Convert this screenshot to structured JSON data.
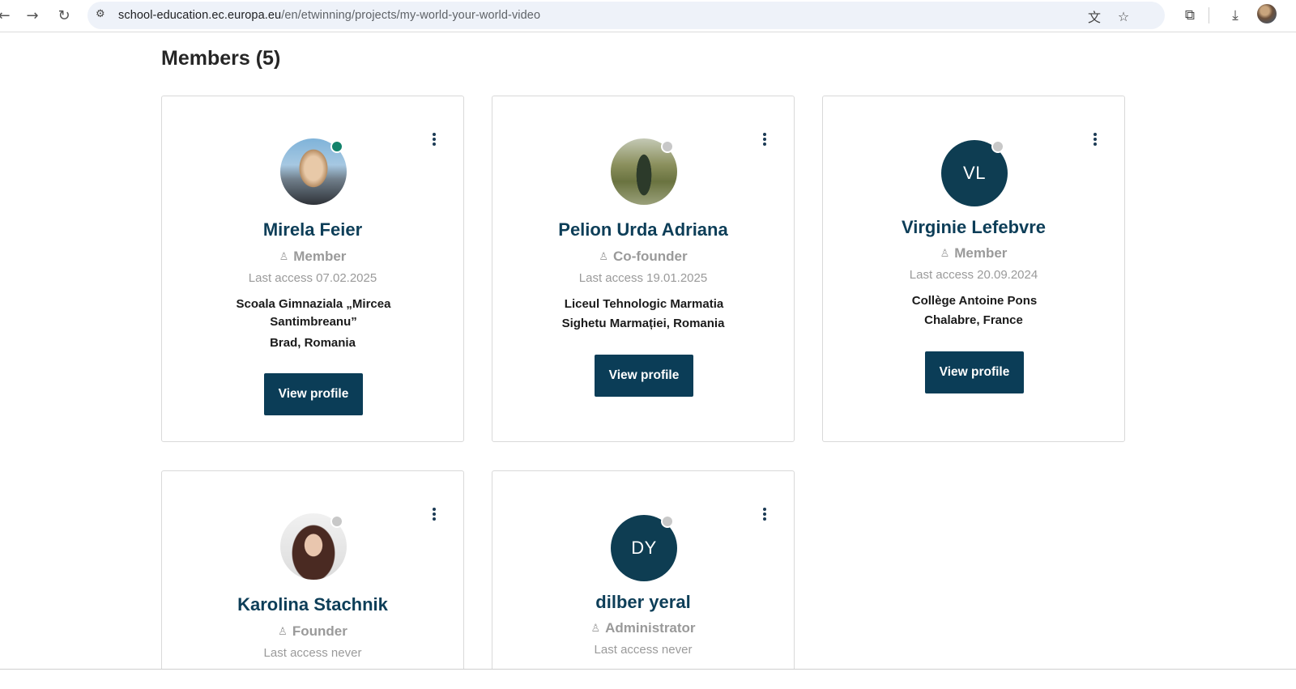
{
  "browser": {
    "url_host": "school-education.ec.europa.eu",
    "url_path": "/en/etwinning/projects/my-world-your-world-video",
    "icons": [
      "back-icon",
      "forward-icon",
      "reload-icon",
      "site-settings-icon",
      "translate-icon",
      "bookmark-star-icon",
      "extensions-icon",
      "download-icon",
      "profile-avatar"
    ]
  },
  "page": {
    "heading": "Members (5)"
  },
  "members": [
    {
      "name": "Mirela Feier",
      "role": "Member",
      "last_access": "Last access 07.02.2025",
      "org": "Scoala Gimnaziala „Mircea Santimbreanu”",
      "location": "Brad, Romania",
      "button": "View profile",
      "status": "online"
    },
    {
      "name": "Pelion Urda Adriana",
      "role": "Co-founder",
      "last_access": "Last access 19.01.2025",
      "org": "Liceul Tehnologic Marmatia",
      "location": "Sighetu Marmației, Romania",
      "button": "View profile",
      "status": "offline"
    },
    {
      "name": "Virginie Lefebvre",
      "initials": "VL",
      "role": "Member",
      "last_access": "Last access 20.09.2024",
      "org": "Collège Antoine Pons",
      "location": "Chalabre, France",
      "button": "View profile",
      "status": "offline"
    },
    {
      "name": "Karolina Stachnik",
      "role": "Founder",
      "last_access": "Last access never",
      "status": "offline"
    },
    {
      "name": "dilber yeral",
      "initials": "DY",
      "role": "Administrator",
      "last_access": "Last access never",
      "status": "offline"
    }
  ],
  "colors": {
    "primary": "#0b3d57",
    "name": "#0d3e58",
    "online": "#13826b",
    "offline": "#c8c8c8",
    "muted": "#9a9a9a"
  }
}
